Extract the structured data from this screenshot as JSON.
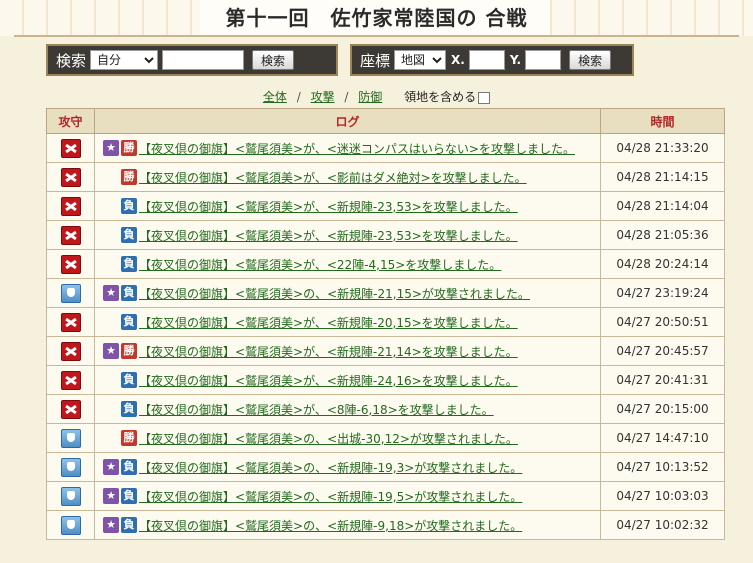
{
  "title": "第十一回　佐竹家常陸国の 合戦",
  "search": {
    "label": "検索",
    "select_value": "自分",
    "input_value": "",
    "button": "検索"
  },
  "coords": {
    "label": "座標",
    "select_value": "地図",
    "x_label": "X.",
    "y_label": "Y.",
    "x_value": "",
    "y_value": "",
    "button": "検索"
  },
  "filters": {
    "all": "全体",
    "attack": "攻撃",
    "defense": "防御",
    "sep": "/",
    "territory_label": "領地を含める"
  },
  "table": {
    "headers": {
      "att": "攻守",
      "log": "ログ",
      "time": "時間"
    },
    "rows": [
      {
        "type": "attack",
        "star": true,
        "result": "勝",
        "text": "【夜叉倶の御旗】<鷲尾須美>が、<迷迷コンパスはいらない>を攻撃しました。",
        "time": "04/28 21:33:20"
      },
      {
        "type": "attack",
        "star": false,
        "result": "勝",
        "text": "【夜叉倶の御旗】<鷲尾須美>が、<影前はダメ絶対>を攻撃しました。",
        "time": "04/28 21:14:15"
      },
      {
        "type": "attack",
        "star": false,
        "result": "負",
        "text": "【夜叉倶の御旗】<鷲尾須美>が、<新規陣-23,53>を攻撃しました。",
        "time": "04/28 21:14:04"
      },
      {
        "type": "attack",
        "star": false,
        "result": "負",
        "text": "【夜叉倶の御旗】<鷲尾須美>が、<新規陣-23,53>を攻撃しました。",
        "time": "04/28 21:05:36"
      },
      {
        "type": "attack",
        "star": false,
        "result": "負",
        "text": "【夜叉倶の御旗】<鷲尾須美>が、<22陣-4,15>を攻撃しました。",
        "time": "04/28 20:24:14"
      },
      {
        "type": "defense",
        "star": true,
        "result": "負",
        "text": "【夜叉倶の御旗】<鷲尾須美>の、<新規陣-21,15>が攻撃されました。",
        "time": "04/27 23:19:24"
      },
      {
        "type": "attack",
        "star": false,
        "result": "負",
        "text": "【夜叉倶の御旗】<鷲尾須美>が、<新規陣-20,15>を攻撃しました。",
        "time": "04/27 20:50:51"
      },
      {
        "type": "attack",
        "star": true,
        "result": "勝",
        "text": "【夜叉倶の御旗】<鷲尾須美>が、<新規陣-21,14>を攻撃しました。",
        "time": "04/27 20:45:57"
      },
      {
        "type": "attack",
        "star": false,
        "result": "負",
        "text": "【夜叉倶の御旗】<鷲尾須美>が、<新規陣-24,16>を攻撃しました。",
        "time": "04/27 20:41:31"
      },
      {
        "type": "attack",
        "star": false,
        "result": "負",
        "text": "【夜叉倶の御旗】<鷲尾須美>が、<8陣-6,18>を攻撃しました。",
        "time": "04/27 20:15:00"
      },
      {
        "type": "defense",
        "star": false,
        "result": "勝",
        "text": "【夜叉倶の御旗】<鷲尾須美>の、<出城-30,12>が攻撃されました。",
        "time": "04/27 14:47:10"
      },
      {
        "type": "defense",
        "star": true,
        "result": "負",
        "text": "【夜叉倶の御旗】<鷲尾須美>の、<新規陣-19,3>が攻撃されました。",
        "time": "04/27 10:13:52"
      },
      {
        "type": "defense",
        "star": true,
        "result": "負",
        "text": "【夜叉倶の御旗】<鷲尾須美>の、<新規陣-19,5>が攻撃されました。",
        "time": "04/27 10:03:03"
      },
      {
        "type": "defense",
        "star": true,
        "result": "負",
        "text": "【夜叉倶の御旗】<鷲尾須美>の、<新規陣-9,18>が攻撃されました。",
        "time": "04/27 10:02:32"
      }
    ]
  },
  "colors": {
    "attack_icon": "#c0171c",
    "defense_icon": "#4f8fc6",
    "win_badge": "#c0392b",
    "lose_badge": "#2f6fb0",
    "star_badge": "#7e53a8",
    "link": "#236a1e"
  },
  "icons": {
    "attack": "crossed-swords-icon",
    "defense": "shield-icon",
    "star": "star-icon"
  }
}
